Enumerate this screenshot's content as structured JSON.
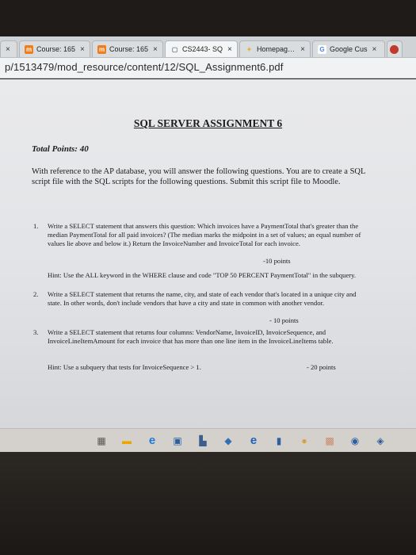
{
  "browser": {
    "tabs": [
      {
        "icon": "moodle-icon",
        "glyph": "m",
        "color": "#f27b1a",
        "title": "Course: 165",
        "active": false
      },
      {
        "icon": "moodle-icon",
        "glyph": "m",
        "color": "#f27b1a",
        "title": "Course: 165",
        "active": false
      },
      {
        "icon": "document-icon",
        "glyph": "▢",
        "color": "#7a7a7a",
        "title": "CS2443- SQ",
        "active": true
      },
      {
        "icon": "homepage-icon",
        "glyph": "✦",
        "color": "#e2b13c",
        "title": "Homepage -",
        "active": false
      },
      {
        "icon": "google-icon",
        "glyph": "G",
        "color": "#4285f4",
        "title": "Google Cus",
        "active": false
      }
    ],
    "address": "p/1513479/mod_resource/content/12/SQL_Assignment6.pdf"
  },
  "document": {
    "title": "SQL SERVER ASSIGNMENT 6",
    "total_points": "Total Points: 40",
    "intro": "With reference to the AP database, you will answer the following questions. You are to create a SQL script file with the SQL scripts for the following questions. Submit this script file to Moodle.",
    "questions": [
      {
        "num": "1.",
        "text": "Write a SELECT statement that answers this question: Which invoices have a PaymentTotal that's greater than the median PaymentTotal for all paid invoices? (The median marks the midpoint in a set of values; an equal number of values lie above and below it.) Return the InvoiceNumber and InvoiceTotal for each invoice.",
        "points": "-10 points",
        "hint": "Hint: Use the ALL keyword in the WHERE clause and code \"TOP 50 PERCENT PaymentTotal\" in the subquery."
      },
      {
        "num": "2.",
        "text": "Write a SELECT statement that returns the name, city, and state of each vendor that's located in a unique city and state. In other words, don't include vendors that have a city and state in common with another vendor.",
        "points": "- 10 points"
      },
      {
        "num": "3.",
        "text": "Write a SELECT statement that returns four columns: VendorName, InvoiceID, InvoiceSequence, and InvoiceLineItemAmount for each invoice that has more than one line item in the InvoiceLineItems table.",
        "hint": "Hint: Use a subquery that tests for InvoiceSequence > 1.",
        "points": "- 20 points"
      }
    ]
  },
  "taskbar": [
    {
      "icon": "calculator-icon",
      "glyph": "▦",
      "color": "#555"
    },
    {
      "icon": "notes-icon",
      "glyph": "▬",
      "color": "#e9a700"
    },
    {
      "icon": "edge-icon",
      "glyph": "e",
      "color": "#1f7ad6"
    },
    {
      "icon": "store-icon",
      "glyph": "▣",
      "color": "#2b5f9e"
    },
    {
      "icon": "files-icon",
      "glyph": "▙",
      "color": "#3b5e8c"
    },
    {
      "icon": "photos-icon",
      "glyph": "◆",
      "color": "#2f6fb8"
    },
    {
      "icon": "ie-icon",
      "glyph": "e",
      "color": "#1d64b8"
    },
    {
      "icon": "office-icon",
      "glyph": "▮",
      "color": "#2f5f9c"
    },
    {
      "icon": "chrome-icon",
      "glyph": "●",
      "color": "#d9a032"
    },
    {
      "icon": "app-icon",
      "glyph": "▩",
      "color": "#c98b6a"
    },
    {
      "icon": "settings-icon",
      "glyph": "◉",
      "color": "#2d5ea0"
    },
    {
      "icon": "shield-icon",
      "glyph": "◈",
      "color": "#2f5e95"
    }
  ]
}
